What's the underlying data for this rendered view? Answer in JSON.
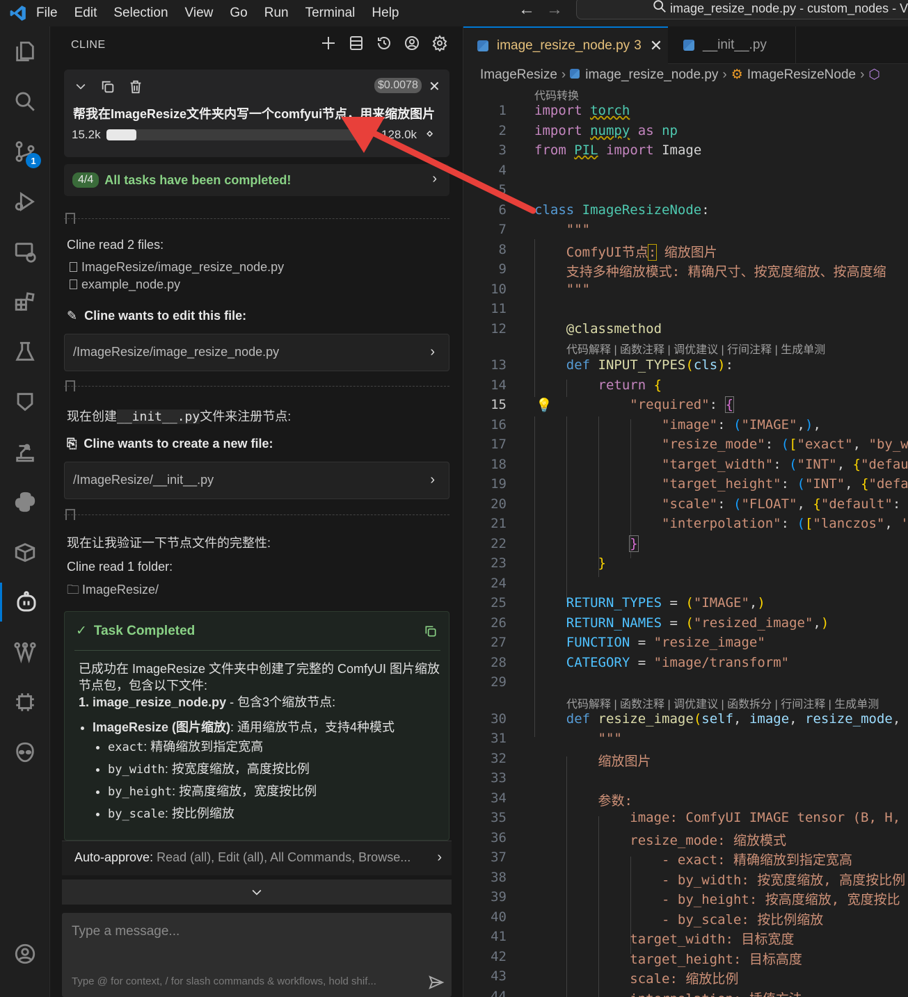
{
  "menu": [
    "File",
    "Edit",
    "Selection",
    "View",
    "Go",
    "Run",
    "Terminal",
    "Help"
  ],
  "window_title": "image_resize_node.py - custom_nodes - Vi",
  "activity": {
    "scm_badge": "1"
  },
  "sidebar": {
    "title": "CLINE",
    "task": {
      "cost": "$0.0078",
      "text": "帮我在ImageResize文件夹内写一个comfyui节点，用来缩放图片",
      "tokens_used": "15.2k",
      "tokens_max": "128.0k",
      "context_fraction": 0.119
    },
    "todo": {
      "count": "4/4",
      "text": "All tasks have been completed!"
    },
    "read_files": {
      "heading": "Cline read 2 files:",
      "files": [
        "ImageResize/image_resize_node.py",
        "example_node.py"
      ]
    },
    "edit": {
      "heading": "Cline wants to edit this file:",
      "path": "/ImageResize/image_resize_node.py"
    },
    "msg1": {
      "prefix": "现在创建",
      "code": "__init__.py",
      "suffix": "文件来注册节点:"
    },
    "create": {
      "heading": "Cline wants to create a new file:",
      "path": "/ImageResize/__init__.py"
    },
    "msg2": "现在让我验证一下节点文件的完整性:",
    "read_folder": {
      "heading": "Cline read 1 folder:",
      "folder": "ImageResize/"
    },
    "completed": {
      "heading": "Task Completed",
      "intro": "已成功在 ImageResize 文件夹中创建了完整的 ComfyUI 图片缩放节点包，包含以下文件:",
      "item1_title": "1. image_resize_node.py",
      "item1_rest": " - 包含3个缩放节点:",
      "bullet_title": "ImageResize (图片缩放)",
      "bullet_rest": ": 通用缩放节点，支持4种模式",
      "modes": [
        {
          "code": "exact",
          "text": ": 精确缩放到指定宽高"
        },
        {
          "code": "by_width",
          "text": ": 按宽度缩放，高度按比例"
        },
        {
          "code": "by_height",
          "text": ": 按高度缩放，宽度按比例"
        },
        {
          "code": "by_scale",
          "text": ": 按比例缩放"
        }
      ]
    },
    "auto_approve": {
      "label": "Auto-approve:",
      "value": "Read (all), Edit (all), All Commands, Browse..."
    },
    "input": {
      "placeholder": "Type a message...",
      "hint": "Type @ for context, / for slash commands & workflows, hold shif..."
    }
  },
  "editor": {
    "tabs": [
      {
        "label": "image_resize_node.py",
        "problems": "3"
      },
      {
        "label": "__init__.py"
      }
    ],
    "breadcrumbs": [
      "ImageResize",
      "image_resize_node.py",
      "ImageResizeNode"
    ],
    "codelens_top": "代码转换",
    "codelens_mid": "代码解释 | 函数注释 | 调优建议 | 行间注释 | 生成单测",
    "codelens_low": "代码解释 | 函数注释 | 调优建议 | 函数拆分 | 行间注释 | 生成单测",
    "current_line": 15
  }
}
